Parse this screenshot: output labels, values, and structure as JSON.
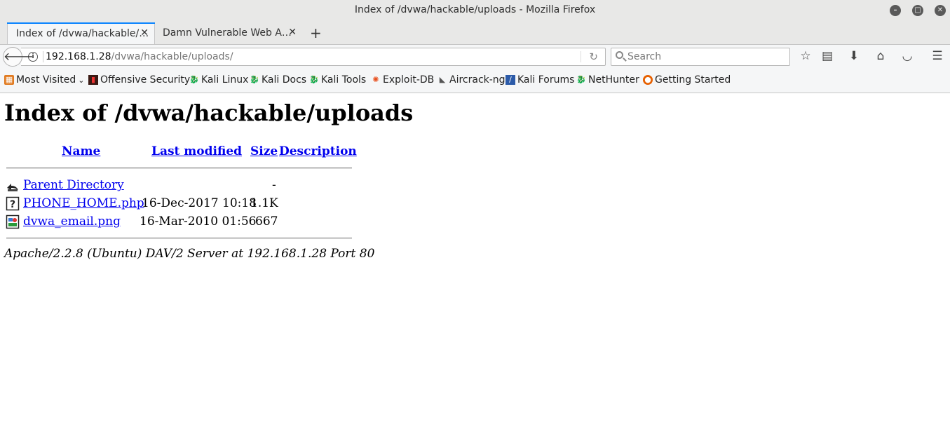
{
  "window": {
    "title": "Index of /dvwa/hackable/uploads - Mozilla Firefox"
  },
  "tabs": [
    {
      "label": "Index of /dvwa/hackable/…",
      "active": true
    },
    {
      "label": "Damn Vulnerable Web A…",
      "active": false
    }
  ],
  "navbar": {
    "url_host": "192.168.1.28",
    "url_path": "/dvwa/hackable/uploads/",
    "search_placeholder": "Search"
  },
  "bookmarks": [
    {
      "label": "Most Visited",
      "icon": "most-visited-icon"
    },
    {
      "label": "Offensive Security",
      "icon": "offensive-security-icon"
    },
    {
      "label": "Kali Linux",
      "icon": "kali-icon"
    },
    {
      "label": "Kali Docs",
      "icon": "kali-icon"
    },
    {
      "label": "Kali Tools",
      "icon": "kali-icon"
    },
    {
      "label": "Exploit-DB",
      "icon": "exploit-db-icon"
    },
    {
      "label": "Aircrack-ng",
      "icon": "aircrack-icon"
    },
    {
      "label": "Kali Forums",
      "icon": "kali-forums-icon"
    },
    {
      "label": "NetHunter",
      "icon": "kali-icon"
    },
    {
      "label": "Getting Started",
      "icon": "firefox-icon"
    }
  ],
  "page": {
    "heading": "Index of /dvwa/hackable/uploads",
    "columns": {
      "name": "Name",
      "last_modified": "Last modified",
      "size": "Size",
      "description": "Description"
    },
    "rows": [
      {
        "name": "Parent Directory",
        "modified": "",
        "size": "-",
        "icon": "back-folder-icon"
      },
      {
        "name": "PHONE_HOME.php",
        "modified": "16-Dec-2017 10:18",
        "size": "1.1K",
        "icon": "unknown-file-icon"
      },
      {
        "name": "dvwa_email.png",
        "modified": "16-Mar-2010 01:56",
        "size": "667",
        "icon": "image-file-icon"
      }
    ],
    "footer": "Apache/2.2.8 (Ubuntu) DAV/2 Server at 192.168.1.28 Port 80"
  }
}
